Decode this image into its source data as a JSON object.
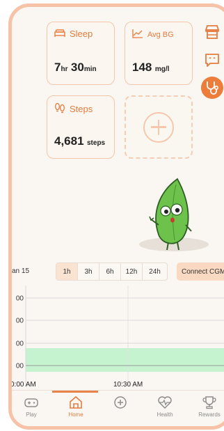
{
  "cards": {
    "sleep": {
      "title": "Sleep",
      "hours": "7",
      "hours_unit": "hr",
      "minutes": "30",
      "minutes_unit": "min"
    },
    "avg_bg": {
      "title": "Avg BG",
      "value": "148",
      "unit": "mg/l"
    },
    "steps": {
      "title": "Steps",
      "value": "4,681",
      "unit": "steps"
    }
  },
  "sidebar": {
    "icons": [
      "store-icon",
      "chat-icon",
      "stethoscope-icon"
    ]
  },
  "chart": {
    "date_label": "an 15",
    "ranges": [
      "1h",
      "3h",
      "6h",
      "12h",
      "24h"
    ],
    "active_range": "1h",
    "connect_label": "Connect CGM",
    "y_ticks": [
      "00",
      "00",
      "00",
      "00"
    ],
    "x_ticks": [
      "0:00 AM",
      "10:30 AM"
    ]
  },
  "chart_data": {
    "type": "line",
    "title": "",
    "xlabel": "",
    "ylabel": "",
    "x": [
      "0:00 AM",
      "10:30 AM"
    ],
    "series": [],
    "y_tick_labels": [
      "00",
      "00",
      "00",
      "00"
    ],
    "target_band": "shaded green band between the third and fourth gridline",
    "grid": true
  },
  "tabbar": {
    "tabs": [
      {
        "label": "Play",
        "icon": "gamepad-icon"
      },
      {
        "label": "Home",
        "icon": "home-icon"
      },
      {
        "label": "",
        "icon": "add-circle-icon"
      },
      {
        "label": "Health",
        "icon": "heart-pulse-icon"
      },
      {
        "label": "Rewards",
        "icon": "trophy-icon"
      }
    ],
    "active": "Home"
  },
  "colors": {
    "accent": "#e57b3f",
    "card_border": "#f3c6ab",
    "background": "#faf7f2",
    "target_band": "#c6f3cf",
    "mascot_green": "#6cc24a"
  }
}
